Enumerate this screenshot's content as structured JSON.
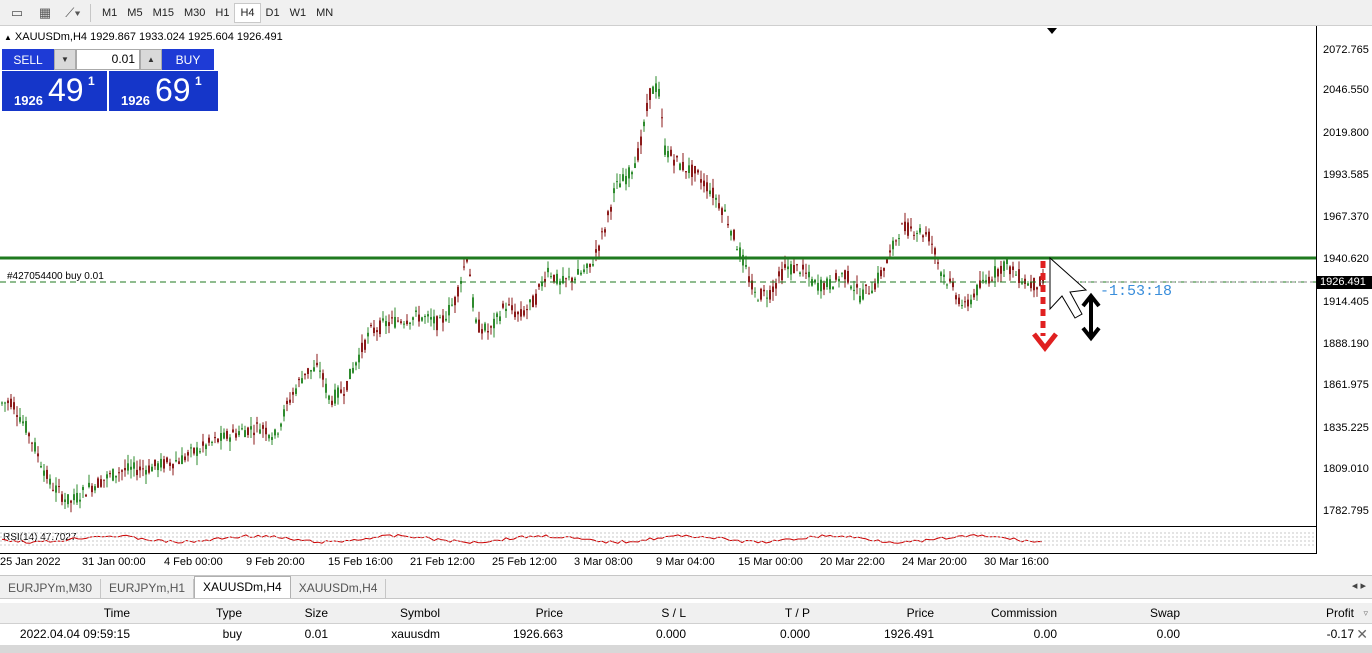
{
  "toolbar": {
    "icons": [
      "window-icon",
      "chart-grid-icon",
      "line-tools-icon"
    ],
    "timeframes": [
      "M1",
      "M5",
      "M15",
      "M30",
      "H1",
      "H4",
      "D1",
      "W1",
      "MN"
    ],
    "active_timeframe": "H4"
  },
  "chart": {
    "symbol_info": "XAUUSDm,H4  1929.867 1933.024 1925.604 1926.491",
    "order_label": "#427054400 buy 0.01",
    "countdown": "-1:53:18",
    "rsi_label": "RSI(14) 47.7027",
    "current_price": "1926.491",
    "price_labels": [
      "2072.765",
      "2046.550",
      "2019.800",
      "1993.585",
      "1967.370",
      "1940.620",
      "1914.405",
      "1888.190",
      "1861.975",
      "1835.225",
      "1809.010",
      "1782.795"
    ],
    "time_labels": [
      "25 Jan 2022",
      "31 Jan 00:00",
      "4 Feb 00:00",
      "9 Feb 20:00",
      "15 Feb 16:00",
      "21 Feb 12:00",
      "25 Feb 12:00",
      "3 Mar 08:00",
      "9 Mar 04:00",
      "15 Mar 00:00",
      "20 Mar 22:00",
      "24 Mar 20:00",
      "30 Mar 16:00"
    ],
    "colors": {
      "bull": "#2e8b2e",
      "bear": "#8b1a1a",
      "level_line": "#1f7a1f",
      "rsi": "#cc0000",
      "arrow": "#e02020",
      "countdown": "#3a8edb"
    }
  },
  "trade_panel": {
    "sell_label": "SELL",
    "buy_label": "BUY",
    "lot": "0.01",
    "sell_prefix": "1926",
    "sell_big": "49",
    "sell_sup": "1",
    "buy_prefix": "1926",
    "buy_big": "69",
    "buy_sup": "1"
  },
  "tabs": [
    "EURJPYm,M30",
    "EURJPYm,H1",
    "XAUUSDm,H4",
    "XAUUSDm,H4"
  ],
  "active_tab": 2,
  "terminal": {
    "columns": [
      "Time",
      "Type",
      "Size",
      "Symbol",
      "Price",
      "S / L",
      "T / P",
      "Price",
      "Commission",
      "Swap",
      "Profit"
    ],
    "row": [
      "2022.04.04 09:59:15",
      "buy",
      "0.01",
      "xauusdm",
      "1926.663",
      "0.000",
      "0.000",
      "1926.491",
      "0.00",
      "0.00",
      "-0.17"
    ]
  }
}
